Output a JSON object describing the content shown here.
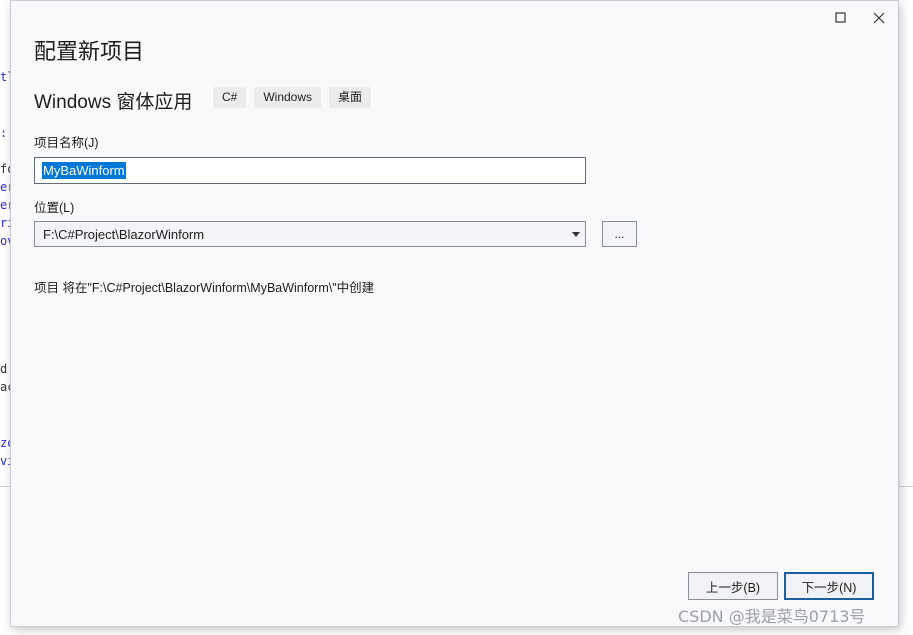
{
  "dialog": {
    "title": "配置新项目",
    "template_name": "Windows 窗体应用",
    "tags": [
      "C#",
      "Windows",
      "桌面"
    ]
  },
  "fields": {
    "project_name_label": "项目名称(J)",
    "project_name_value": "MyBaWinform",
    "location_label": "位置(L)",
    "location_value": "F:\\C#Project\\BlazorWinform",
    "browse_label": "..."
  },
  "create_info": "项目 将在\"F:\\C#Project\\BlazorWinform\\MyBaWinform\\\"中创建",
  "buttons": {
    "back": "上一步(B)",
    "next": "下一步(N)"
  },
  "watermark": "CSDN @我是菜鸟0713号",
  "background_code": [
    "tl",
    ":",
    "fo",
    "er",
    "er",
    "ri",
    "ov",
    "d.",
    "ac",
    "zo",
    "vi"
  ],
  "colors": {
    "selection": "#0078d7",
    "dialog_bg": "#f8f9fb",
    "primary_border": "#1e5f9f"
  }
}
